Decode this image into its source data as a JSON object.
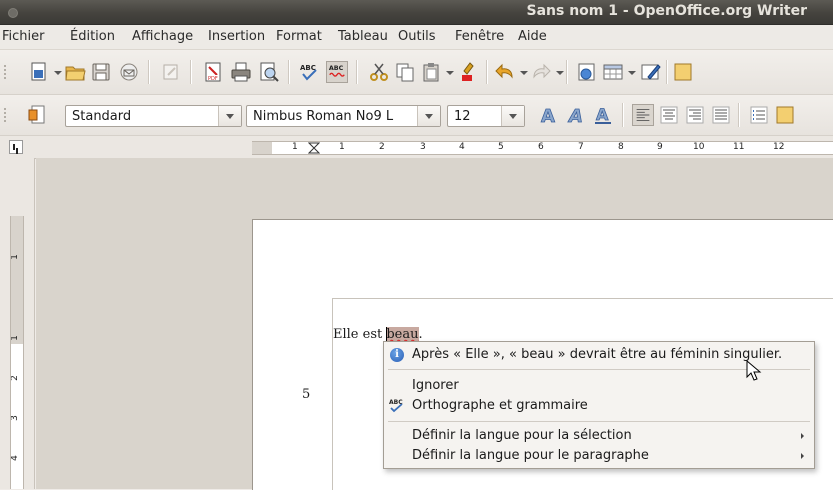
{
  "window": {
    "title": "Sans nom 1 - OpenOffice.org Writer"
  },
  "menu": [
    "Fichier",
    "Édition",
    "Affichage",
    "Insertion",
    "Format",
    "Tableau",
    "Outils",
    "Fenêtre",
    "Aide"
  ],
  "formatting": {
    "paragraph_style": "Standard",
    "font_name": "Nimbus Roman No9 L",
    "font_size": "12"
  },
  "ruler": {
    "h_numbers": [
      "1",
      "1",
      "2",
      "3",
      "4",
      "5",
      "6",
      "7",
      "8",
      "9",
      "10",
      "11",
      "12"
    ],
    "v_numbers": [
      "1",
      "1",
      "2",
      "3",
      "4"
    ]
  },
  "document": {
    "line_number": "5",
    "text_before": "Elle est ",
    "error_word": "beau",
    "text_after": "."
  },
  "context_menu": {
    "suggestion": "Après « Elle », « beau » devrait être au féminin singulier.",
    "ignore": "Ignorer",
    "spelling_grammar": "Orthographe et grammaire",
    "set_language_selection": "Définir la langue pour la sélection",
    "set_language_paragraph": "Définir la langue pour le paragraphe"
  },
  "icons": {
    "info": "info-icon",
    "spellcheck": "spellcheck-icon",
    "submenu": "chevron-right-icon"
  },
  "colors": {
    "error_underline": "#dd2222",
    "selection": "#c8a9a0"
  }
}
